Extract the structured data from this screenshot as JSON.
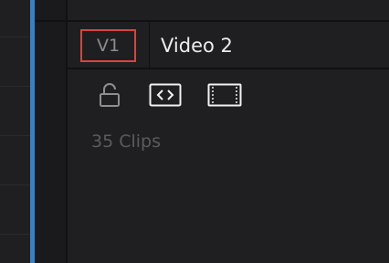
{
  "track": {
    "id_label": "V1",
    "name": "Video 2",
    "clip_count": "35 Clips"
  },
  "icons": {
    "lock": "lock-icon",
    "auto_select": "auto-select-icon",
    "disable_track": "film-strip-icon"
  },
  "colors": {
    "accent_blue": "#3f7fb9",
    "badge_border": "#d8453b",
    "text_primary": "#ececec",
    "text_dim": "#5b5b5e"
  }
}
